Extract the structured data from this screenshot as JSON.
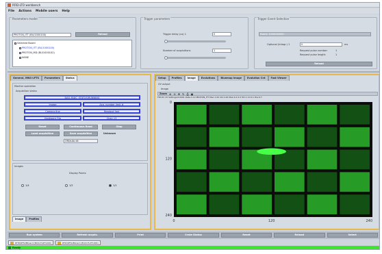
{
  "window": {
    "title": "RFID-LTO workbench"
  },
  "menu": [
    "File",
    "Actions",
    "Mobile users",
    "Help"
  ],
  "parameter_set": {
    "title": "Parameters model",
    "field_value": "PROTON_ITT (BU/1000100)",
    "button_label": "Reload",
    "tree": {
      "root": "Selected Board",
      "items": [
        "PROTON_ITT (BU/1000100)",
        "PROTON_MD (BU/1000102)",
        "NONE"
      ]
    }
  },
  "trigger_params": {
    "title": "Trigger parameters",
    "delay_label": "Trigger delay (us) 1",
    "delay_value": "0",
    "acq_label": "Number of acquisitions",
    "acq_value": "1"
  },
  "event_selection": {
    "title": "Trigger Event Selection",
    "select_value": "Event: 1000000000",
    "time_label": "Optional (Integr.) 1",
    "time_value": "0",
    "time_unit": "ms",
    "line1": "Request pulse number:",
    "line1_value": "1",
    "line2": "Request pulse length:",
    "line2_value": "1",
    "button_label": "Reload"
  },
  "left_tabs": [
    "General, MNS-LPTS",
    "Parameters",
    "Status"
  ],
  "left_pane": {
    "section_title": "Monitor operation",
    "subsection": "Acquisition status",
    "blue_buttons": [
      "DAQ-FADC_STATUS/RUNNING",
      "Image",
      "Acq. number limit #",
      "Camera fine",
      "Readout fast",
      "Hardware Flip",
      "Chan 13"
    ],
    "gray_buttons": [
      "Reset",
      "Continuous Read",
      "Stop",
      "Load acquisition",
      "Save acquisition"
    ],
    "status_text": "Unknown",
    "select_value": "Off/auto dir",
    "group_title": "Images",
    "radio_title": "Display Points",
    "radios": [
      "1/4",
      "1/2",
      "1/1"
    ],
    "selected_radio": 2,
    "bottom_tabs": [
      "Image",
      "Profiles"
    ]
  },
  "right_tabs": [
    "Setup",
    "Profiles",
    "Image",
    "Evolutions",
    "Bluemap Image",
    "Evolution Cnt",
    "Fast Viewer"
  ],
  "right_pane": {
    "header": "UV output",
    "sub_header": "Image",
    "toolbar_label": "Zoom",
    "info_line": "FOV:D:=D Settings:6:0001   Date:1.12   PROTON_ITT   Mac:1.00   Clk:1.00   Max:2.0-5.0   Tot:1.11:0:1   Pos:0:7"
  },
  "chart_data": {
    "type": "heatmap",
    "title": "",
    "xlabel": "",
    "ylabel": "",
    "xlim": [
      0,
      244
    ],
    "ylim": [
      0,
      244
    ],
    "x_ticks": [
      0,
      120,
      240
    ],
    "y_ticks": [
      0,
      120,
      240
    ],
    "grid_columns": 6,
    "grid_rows": 5,
    "spot": {
      "x": 120,
      "y": 105,
      "rx": 18,
      "ry": 7
    },
    "colors": {
      "background": "#0a0d0a",
      "cell": "#2bb52b",
      "cell_dark": "#155d15",
      "spot": "#48ff48"
    }
  },
  "bottom_buttons": [
    "Run system",
    "Refresh acquis.",
    "Print",
    "Crate Status",
    "Reset",
    "Reload",
    "Select"
  ],
  "taskbar": [
    "RFID/RFSUBboard (BU/0-FL2F1000)",
    "RFID/RFSUBboard (BU/0-FL2F1000)"
  ],
  "status_bar": {
    "text": "Ready"
  },
  "colors": {
    "accent": "#e8b94a",
    "blue_border": "#3340d8",
    "status_green": "#3ee62b"
  }
}
